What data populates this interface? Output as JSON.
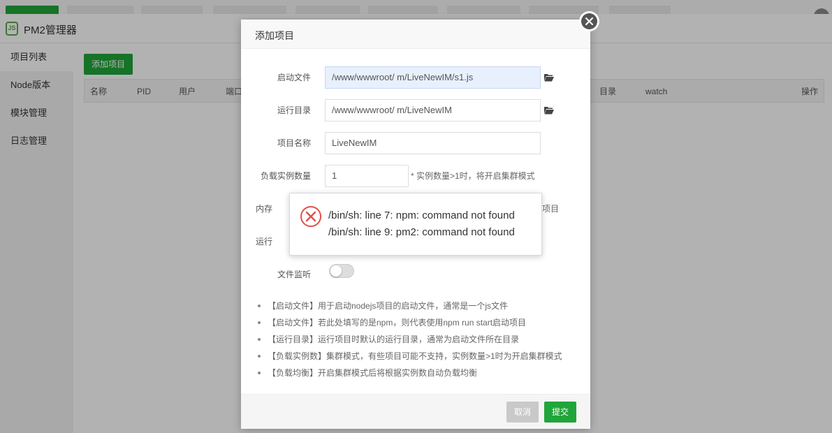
{
  "colors": {
    "brand_green": "#20a53a",
    "error_red": "#e0504a",
    "input_focus_bg": "#e8f0fe"
  },
  "app": {
    "title": "PM2管理器",
    "logo_text": "JS"
  },
  "sidebar": {
    "items": [
      {
        "label": "项目列表",
        "active": true
      },
      {
        "label": "Node版本",
        "active": false
      },
      {
        "label": "模块管理",
        "active": false
      },
      {
        "label": "日志管理",
        "active": false
      }
    ]
  },
  "content": {
    "add_button": "添加项目",
    "table_headers": {
      "name": "名称",
      "pid": "PID",
      "user": "用户",
      "port": "端口",
      "dir": "目录",
      "watch": "watch",
      "actions": "操作"
    }
  },
  "modal": {
    "title": "添加项目",
    "fields": {
      "start_file": {
        "label": "启动文件",
        "value": "/www/wwwroot/          m/LiveNewIM/s1.js"
      },
      "run_dir": {
        "label": "运行目录",
        "value": "/www/wwwroot/          m/LiveNewIM"
      },
      "project_name": {
        "label": "项目名称",
        "value": "LiveNewIM"
      },
      "instances": {
        "label": "负载实例数量",
        "value": "1",
        "hint": "* 实例数量>1时，将开启集群模式"
      },
      "memory": {
        "label_partial": "内存",
        "hint_partial": "项目"
      },
      "run_user": {
        "label_partial": "运行"
      },
      "file_watch": {
        "label": "文件监听",
        "enabled": false
      }
    },
    "help": [
      "【启动文件】用于启动nodejs项目的启动文件，通常是一个js文件",
      "【启动文件】若此处填写的是npm，则代表使用npm run start启动项目",
      "【运行目录】运行项目时默认的运行目录，通常为启动文件所在目录",
      "【负载实例数】集群模式，有些项目可能不支持，实例数量>1时为开启集群模式",
      "【负载均衡】开启集群模式后将根据实例数自动负载均衡"
    ],
    "cancel_label": "取消",
    "submit_label": "提交"
  },
  "error_toast": {
    "lines": [
      "/bin/sh: line 7: npm: command not found",
      "/bin/sh: line 9: pm2: command not found"
    ]
  }
}
